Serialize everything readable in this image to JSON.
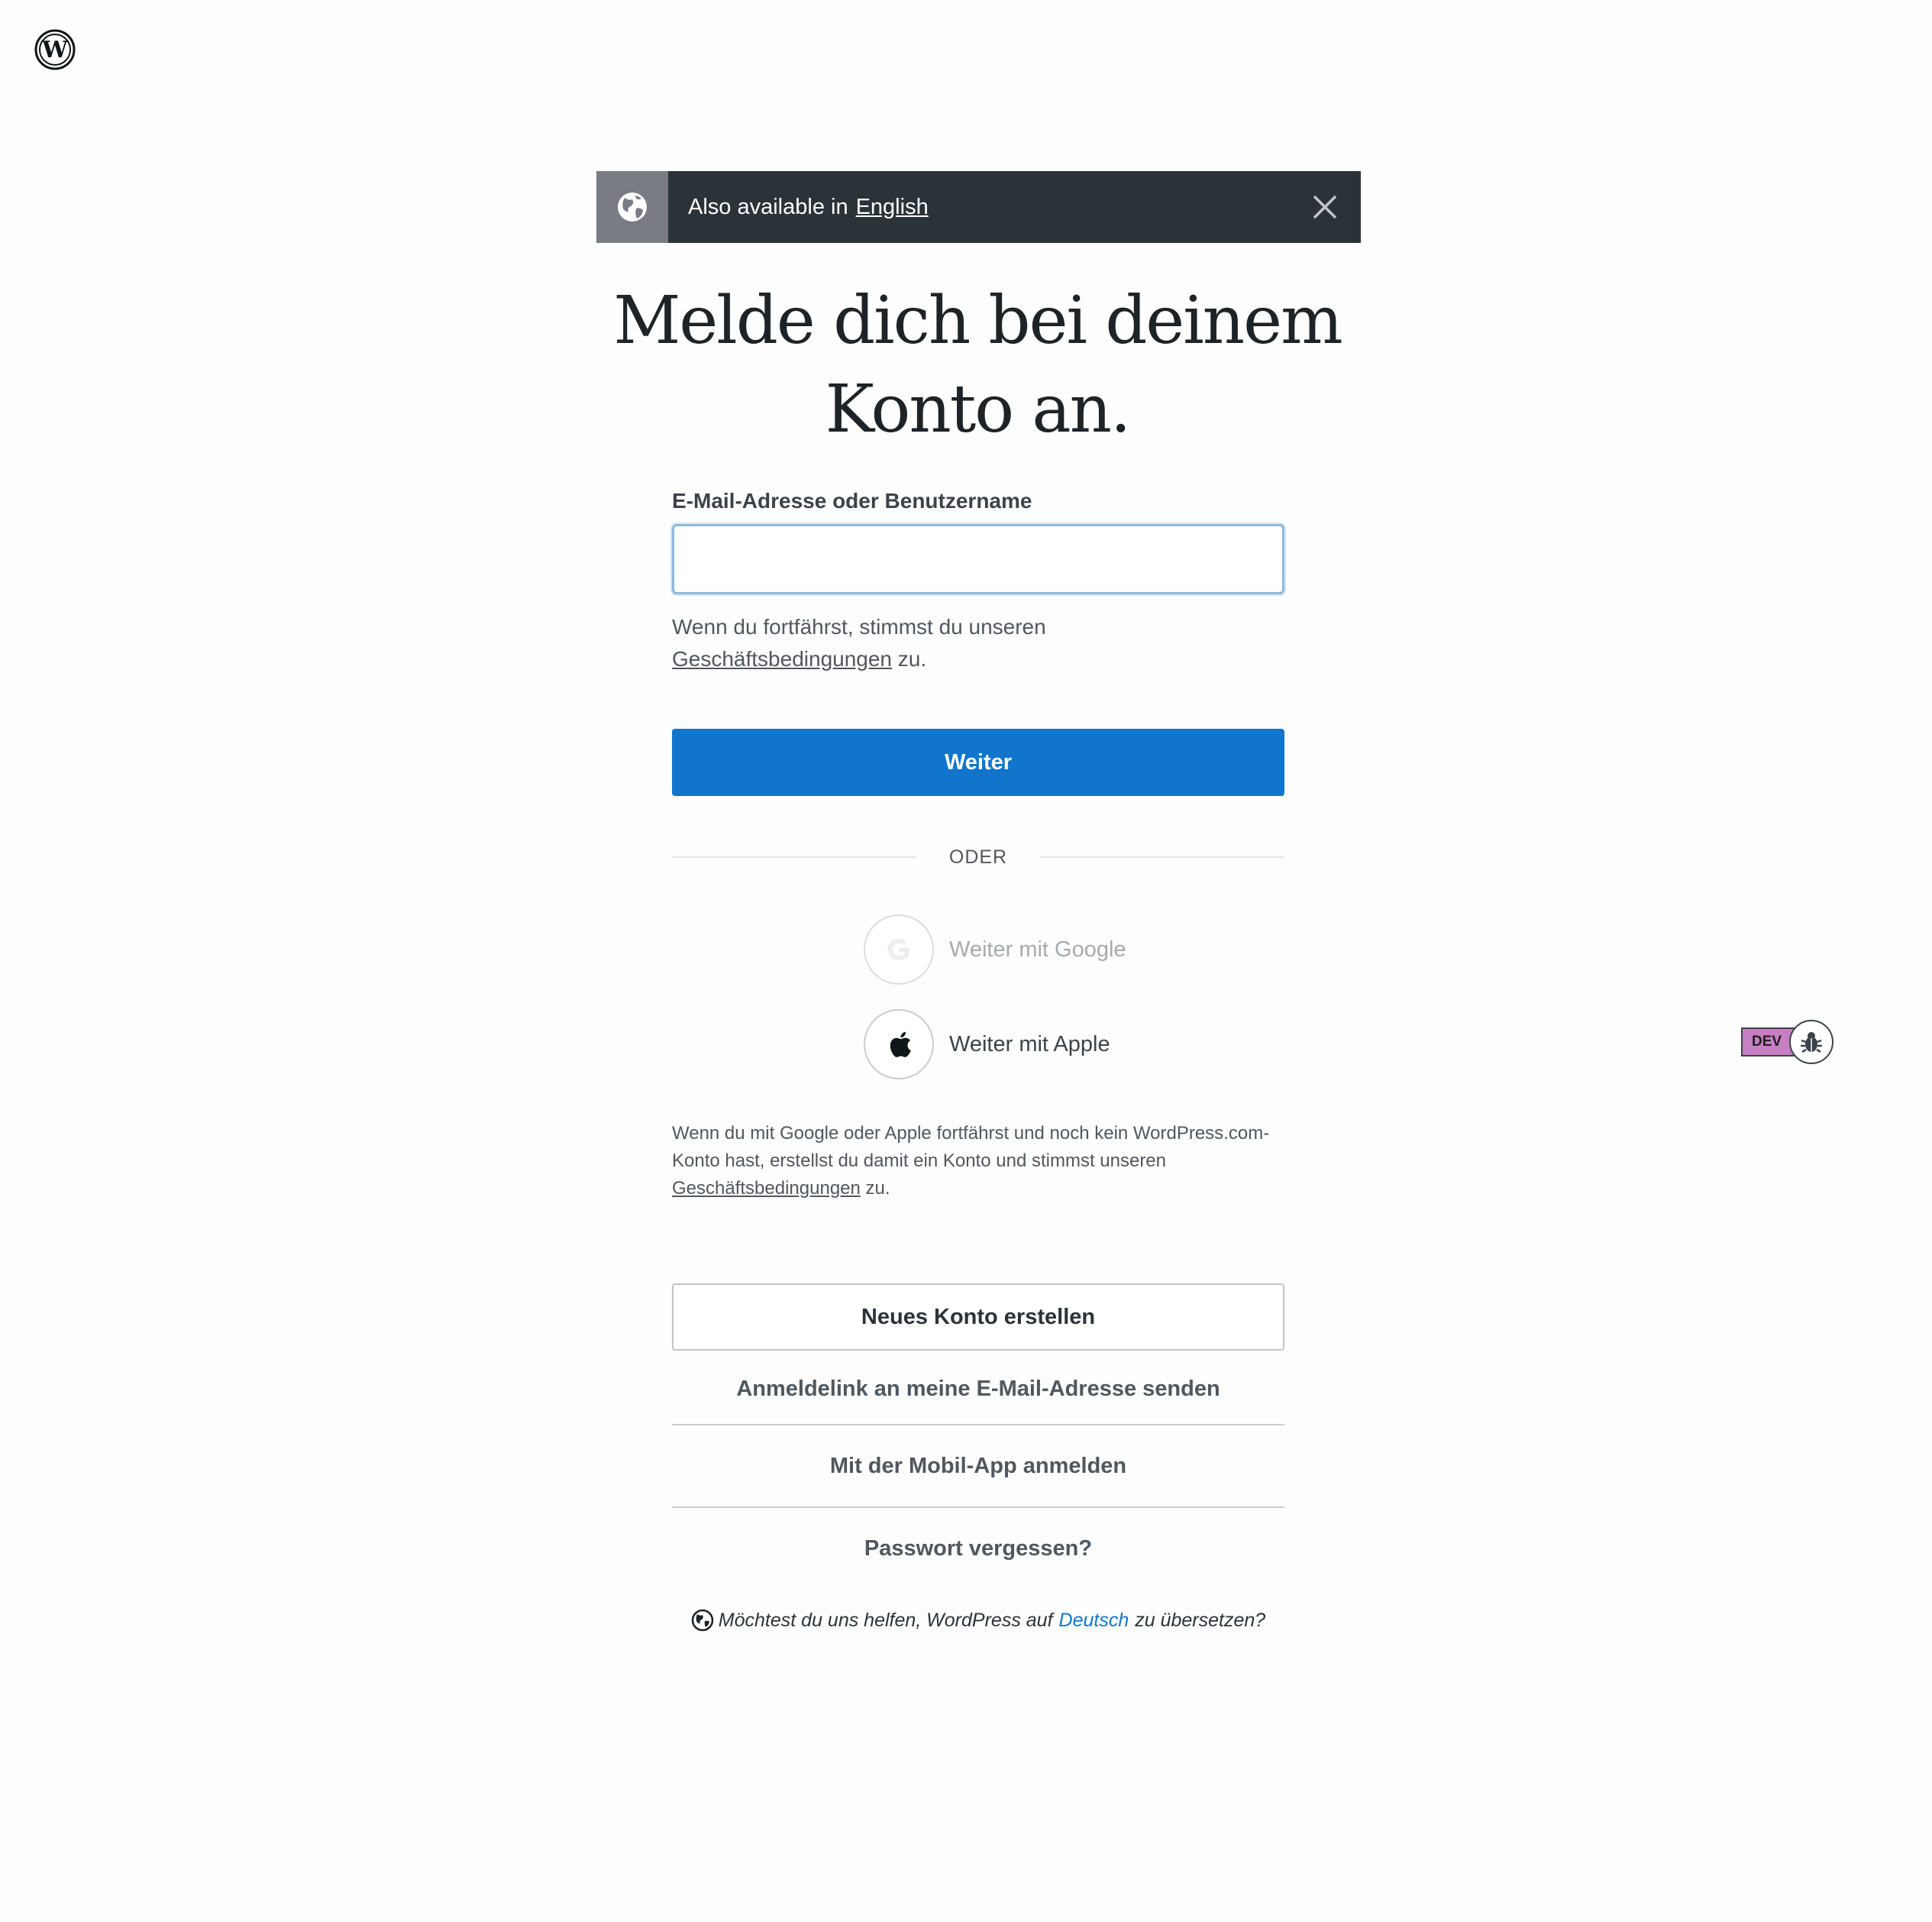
{
  "notice": {
    "text": "Also available in",
    "link": "English"
  },
  "heading": "Melde dich bei deinem Konto an.",
  "login": {
    "label": "E-Mail-Adresse oder Benutzername",
    "value": "",
    "tos_prefix": "Wenn du fortfährst, stimmst du unseren",
    "tos_link": "Geschäftsbedingungen",
    "tos_suffix": "zu.",
    "continue": "Weiter"
  },
  "divider": "ODER",
  "social": {
    "google": "Weiter mit Google",
    "apple": "Weiter mit Apple",
    "tos_prefix": "Wenn du mit Google oder Apple fortfährst und noch kein WordPress.com-Konto hast, erstellst du damit ein Konto und stimmst unseren",
    "tos_link": "Geschäftsbedingungen",
    "tos_suffix": "zu."
  },
  "actions": {
    "create": "Neues Konto erstellen",
    "magic_link": "Anmeldelink an meine E-Mail-Adresse senden",
    "mobile_app": "Mit der Mobil-App anmelden",
    "forgot": "Passwort vergessen?"
  },
  "translate": {
    "prefix": "Möchtest du uns helfen, WordPress auf",
    "language": "Deutsch",
    "suffix": "zu übersetzen?"
  },
  "dev": {
    "badge": "DEV"
  },
  "icons": {
    "logo": "wordpress-logo-icon",
    "notice": "globe-icon",
    "close": "close-icon",
    "google": "google-icon",
    "apple": "apple-icon",
    "bug": "bug-icon"
  },
  "colors": {
    "primary": "#1176cb",
    "notice_bg": "#2c3338",
    "dev_badge": "#c77fc4"
  }
}
